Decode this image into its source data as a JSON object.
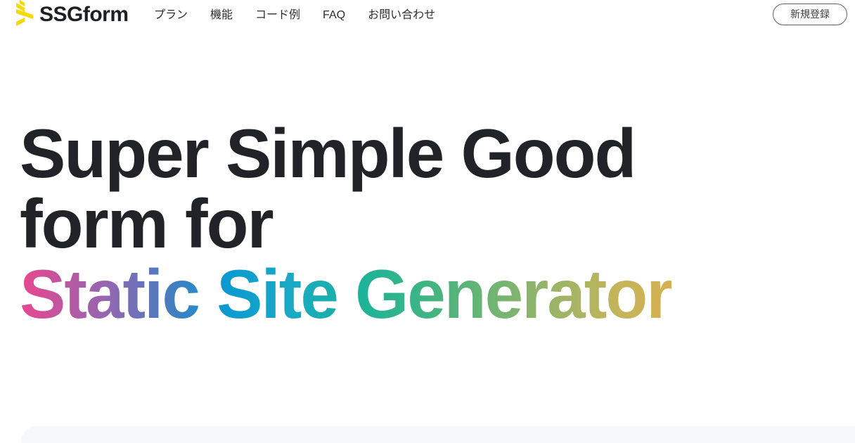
{
  "header": {
    "logo_text": "SSGform",
    "logo_color": "#f5d90a",
    "nav": [
      {
        "label": "プラン"
      },
      {
        "label": "機能"
      },
      {
        "label": "コード例"
      },
      {
        "label": "FAQ"
      },
      {
        "label": "お問い合わせ"
      }
    ],
    "signup_label": "新規登録"
  },
  "hero": {
    "line1": "Super Simple Good",
    "line2": "form for",
    "line3": "Static Site Generator",
    "gradient_colors": [
      "#e9468f",
      "#8f68b2",
      "#3f7fc1",
      "#0b9bd0",
      "#1bb39a",
      "#46b47f",
      "#8ab46c",
      "#d6b052"
    ]
  }
}
